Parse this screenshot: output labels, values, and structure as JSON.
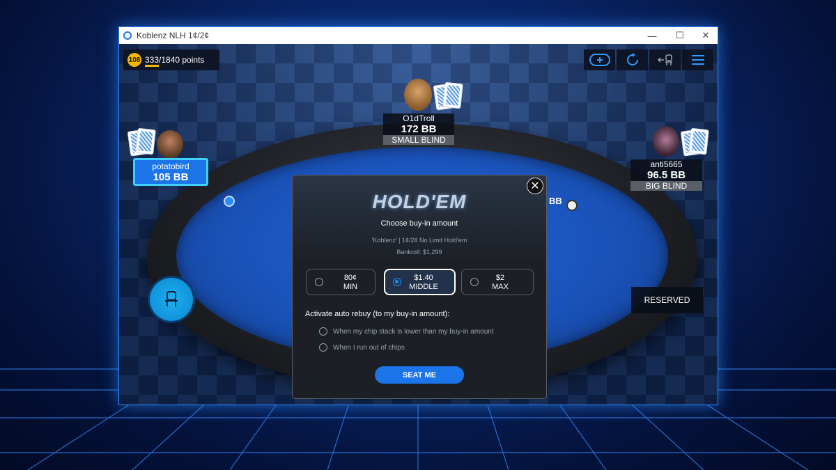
{
  "window": {
    "title": "Koblenz NLH 1¢/2¢"
  },
  "hud": {
    "level_badge": "108",
    "points": "333/1840 points",
    "points_progress": 0.18
  },
  "toolbar": {
    "icons": [
      "add-table-icon",
      "rebuy-refresh-icon",
      "leave-seat-icon",
      "menu-icon"
    ]
  },
  "players": {
    "top": {
      "name": "O1dTroll",
      "stack": "172 BB",
      "label": "SMALL BLIND"
    },
    "left": {
      "name": "potatobird",
      "stack": "105 BB"
    },
    "right": {
      "name": "anti5665",
      "stack": "96.5 BB",
      "label": "BIG BLIND"
    }
  },
  "table": {
    "bb_marker": "BB",
    "reserved": "RESERVED"
  },
  "modal": {
    "logo": "HOLD'EM",
    "subtitle": "Choose buy-in amount",
    "table_info": "'Koblenz' | 1¢/2¢ No Limit Hold'em",
    "bankroll": "Bankroll: $1,299",
    "options": [
      {
        "amount": "80¢",
        "label": "MIN",
        "selected": false
      },
      {
        "amount": "$1.40",
        "label": "MIDDLE",
        "selected": true
      },
      {
        "amount": "$2",
        "label": "MAX",
        "selected": false
      }
    ],
    "rebuy_title": "Activate auto rebuy (to my buy-in amount):",
    "rebuy_options": [
      "When my chip stack is lower than my buy-in amount",
      "When I run out of chips"
    ],
    "seat_button": "SEAT ME",
    "close": "✕"
  },
  "colors": {
    "accent": "#1b74e8",
    "gold": "#f5b800",
    "felt": "#1a52b8"
  }
}
